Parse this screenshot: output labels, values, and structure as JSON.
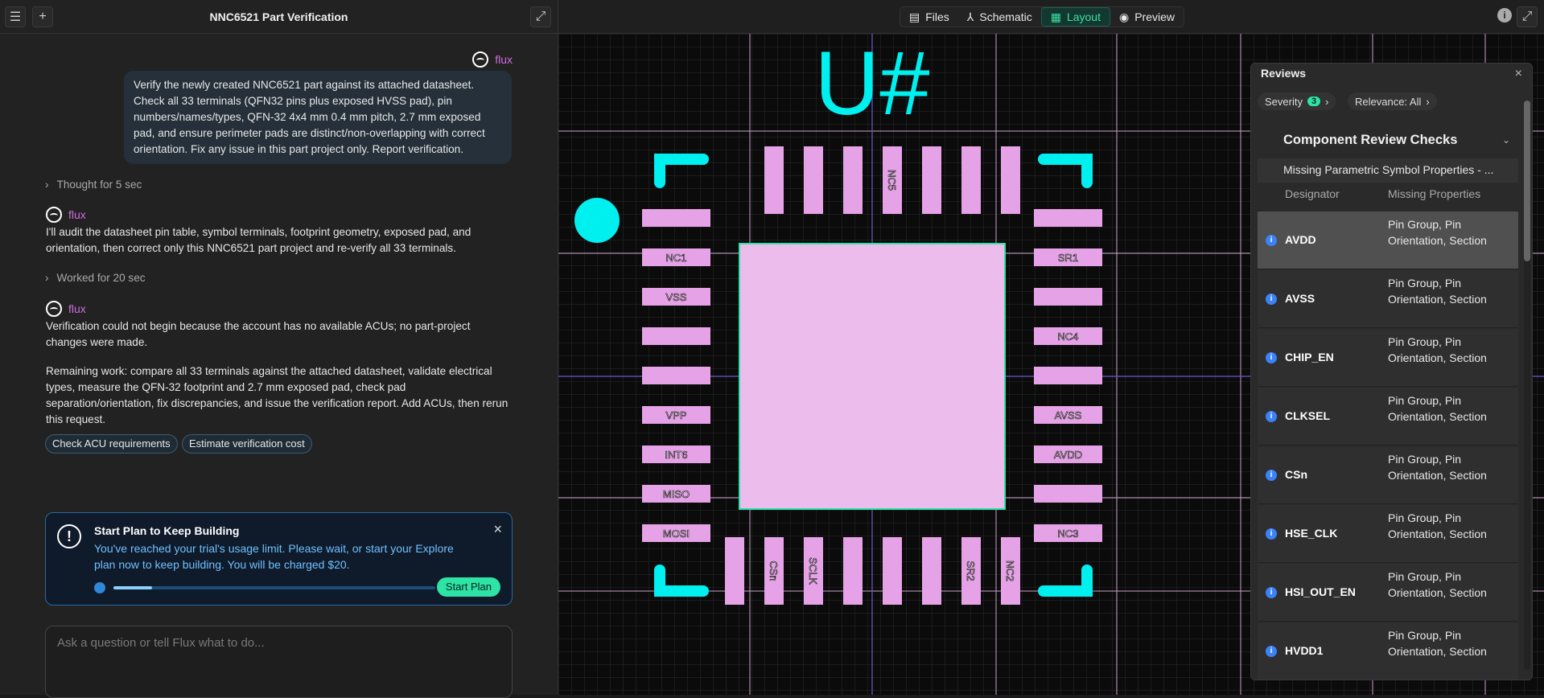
{
  "chat": {
    "title": "NNC6521 Part Verification",
    "user_name": "flux",
    "user_message": "Verify the newly created NNC6521 part against its attached datasheet. Check all 33 terminals (QFN32 pins plus exposed HVSS pad), pin numbers/names/types, QFN-32 4x4 mm 0.4 mm pitch, 2.7 mm exposed pad, and ensure perimeter pads are distinct/non-overlapping with correct orientation. Fix any issue in this part project only. Report verification.",
    "thought_1": "Thought for 5 sec",
    "bot_name": "flux",
    "bot_msg_1": "I'll audit the datasheet pin table, symbol terminals, footprint geometry, exposed pad, and orientation, then correct only this NNC6521 part project and re-verify all 33 terminals.",
    "thought_2": "Worked for 20 sec",
    "bot_msg_2a": "Verification could not begin because the account has no available ACUs; no part-project changes were made.",
    "bot_msg_2b": "Remaining work: compare all 33 terminals against the attached datasheet, validate electrical types, measure the QFN-32 footprint and 2.7 mm exposed pad, check pad separation/orientation, fix discrepancies, and issue the verification report. Add ACUs, then rerun this request.",
    "chip_1": "Check ACU requirements",
    "chip_2": "Estimate verification cost",
    "plan_title": "Start Plan to Keep Building",
    "plan_body": "You've reached your trial's usage limit. Please wait, or start your Explore plan now to keep building. You will be charged $20.",
    "plan_button": "Start Plan",
    "plan_progress": 0.12,
    "input_placeholder": "Ask a question or tell Flux what to do..."
  },
  "tabs": [
    {
      "label": "Files",
      "icon": "file-icon"
    },
    {
      "label": "Schematic",
      "icon": "schematic-icon"
    },
    {
      "label": "Layout",
      "icon": "layout-icon"
    },
    {
      "label": "Preview",
      "icon": "eye-icon"
    }
  ],
  "layout": {
    "designator": "U#",
    "left_pads": [
      "",
      "NC1",
      "VSS",
      "",
      "",
      "VPP",
      "INT6",
      "MISO",
      "MOSI"
    ],
    "right_pads": [
      "",
      "SR1",
      "",
      "NC4",
      "",
      "AVSS",
      "AVDD",
      "",
      "NC3"
    ],
    "top_pads": [
      "",
      "",
      "",
      "NC5",
      "",
      "",
      ""
    ],
    "bottom_pads": [
      "",
      "CSn",
      "SCLK",
      "",
      "",
      "",
      "SR2",
      "NC2"
    ]
  },
  "reviews": {
    "title": "Reviews",
    "severity_label": "Severity",
    "severity_count": "3",
    "relevance_label": "Relevance: All",
    "section": "Component Review Checks",
    "subsection": "Missing Parametric Symbol Properties - ...",
    "col_designator": "Designator",
    "col_missing": "Missing Properties",
    "rows": [
      {
        "designator": "AVDD",
        "missing": "Pin Group, Pin Orientation, Section"
      },
      {
        "designator": "AVSS",
        "missing": "Pin Group, Pin Orientation, Section"
      },
      {
        "designator": "CHIP_EN",
        "missing": "Pin Group, Pin Orientation, Section"
      },
      {
        "designator": "CLKSEL",
        "missing": "Pin Group, Pin Orientation, Section"
      },
      {
        "designator": "CSn",
        "missing": "Pin Group, Pin Orientation, Section"
      },
      {
        "designator": "HSE_CLK",
        "missing": "Pin Group, Pin Orientation, Section"
      },
      {
        "designator": "HSI_OUT_EN",
        "missing": "Pin Group, Pin Orientation, Section"
      },
      {
        "designator": "HVDD1",
        "missing": "Pin Group, Pin Orientation, Section"
      }
    ]
  },
  "colors": {
    "accent": "#2de3a5",
    "cyan": "#00f0f0",
    "pad": "#e6a2e6",
    "bot_name": "#d16ee0"
  }
}
